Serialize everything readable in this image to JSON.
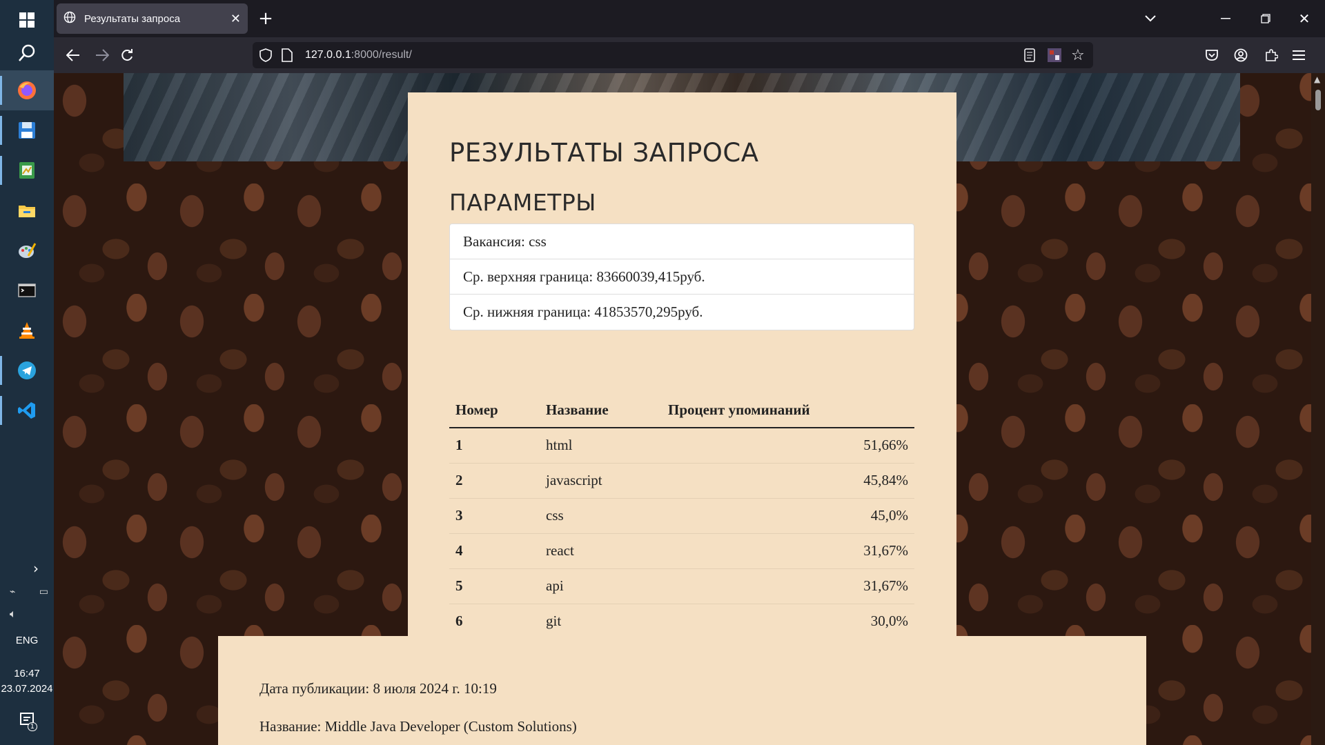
{
  "taskbar": {
    "items": [
      {
        "name": "start-button",
        "icon": "windows-logo-icon"
      },
      {
        "name": "search-button",
        "icon": "search-icon"
      },
      {
        "name": "firefox",
        "icon": "firefox-icon"
      },
      {
        "name": "save-app",
        "icon": "floppy-icon"
      },
      {
        "name": "sheet-app",
        "icon": "spreadsheet-icon"
      },
      {
        "name": "file-explorer",
        "icon": "folder-icon"
      },
      {
        "name": "paint-app",
        "icon": "paint-icon"
      },
      {
        "name": "terminal",
        "icon": "terminal-icon"
      },
      {
        "name": "vlc",
        "icon": "vlc-cone-icon"
      },
      {
        "name": "telegram",
        "icon": "telegram-icon"
      },
      {
        "name": "vscode",
        "icon": "vscode-icon"
      }
    ],
    "language": "ENG",
    "time": "16:47",
    "date": "23.07.2024",
    "notification_count": "1"
  },
  "browser": {
    "tab_title": "Результаты запроса",
    "url_host": "127.0.0.1",
    "url_path": ":8000/result/"
  },
  "page": {
    "title": "РЕЗУЛЬТАТЫ ЗАПРОСА",
    "params_title": "ПАРАМЕТРЫ",
    "params": [
      "Вакансия: css",
      "Ср. верхняя граница: 83660039,415руб.",
      "Ср. нижняя граница: 41853570,295руб."
    ],
    "table": {
      "headers": [
        "Номер",
        "Название",
        "Процент упоминаний"
      ],
      "rows": [
        [
          "1",
          "html",
          "51,66%"
        ],
        [
          "2",
          "javascript",
          "45,84%"
        ],
        [
          "3",
          "css",
          "45,0%"
        ],
        [
          "4",
          "react",
          "31,67%"
        ],
        [
          "5",
          "api",
          "31,67%"
        ],
        [
          "6",
          "git",
          "30,0%"
        ]
      ]
    },
    "vacancy": {
      "date_line": "Дата публикации: 8 июля 2024 г. 10:19",
      "name_line": "Название: Middle Java Developer (Custom Solutions)"
    }
  },
  "colors": {
    "card": "#f5e0c3",
    "taskbar": "#1d2f3f",
    "browser_tabbar": "#1c1b22",
    "browser_navbar": "#2b2a33"
  }
}
